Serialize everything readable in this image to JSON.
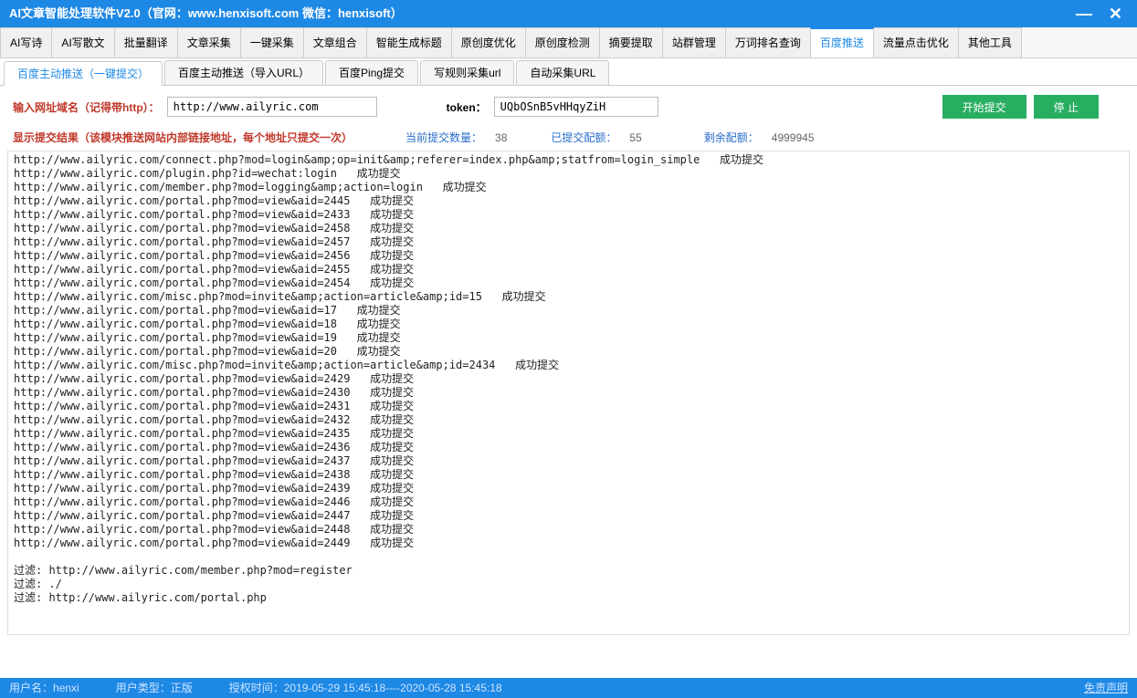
{
  "title": "AI文章智能处理软件V2.0（官网：www.henxisoft.com  微信：henxisoft）",
  "main_tabs": [
    "AI写诗",
    "AI写散文",
    "批量翻译",
    "文章采集",
    "一键采集",
    "文章组合",
    "智能生成标题",
    "原创度优化",
    "原创度检测",
    "摘要提取",
    "站群管理",
    "万词排名查询",
    "百度推送",
    "流量点击优化",
    "其他工具"
  ],
  "main_tab_active": 12,
  "sub_tabs": [
    "百度主动推送（一键提交）",
    "百度主动推送（导入URL）",
    "百度Ping提交",
    "写规则采集url",
    "自动采集URL"
  ],
  "sub_tab_active": 0,
  "input": {
    "domain_label": "输入网址域名（记得带http）：",
    "domain_value": "http://www.ailyric.com",
    "token_label": "token：",
    "token_value": "UQbOSnB5vHHqyZiH",
    "start_btn": "开始提交",
    "stop_btn": "停  止"
  },
  "status": {
    "result_label": "显示提交结果（该模块推送网站内部链接地址，每个地址只提交一次）",
    "current_label": "当前提交数量：",
    "current_val": "38",
    "submitted_label": "已提交配额：",
    "submitted_val": "55",
    "remain_label": "剩余配额：",
    "remain_val": "4999945"
  },
  "log_lines": [
    "http://www.ailyric.com/connect.php?mod=login&amp;op=init&amp;referer=index.php&amp;statfrom=login_simple   成功提交",
    "http://www.ailyric.com/plugin.php?id=wechat:login   成功提交",
    "http://www.ailyric.com/member.php?mod=logging&amp;action=login   成功提交",
    "http://www.ailyric.com/portal.php?mod=view&aid=2445   成功提交",
    "http://www.ailyric.com/portal.php?mod=view&aid=2433   成功提交",
    "http://www.ailyric.com/portal.php?mod=view&aid=2458   成功提交",
    "http://www.ailyric.com/portal.php?mod=view&aid=2457   成功提交",
    "http://www.ailyric.com/portal.php?mod=view&aid=2456   成功提交",
    "http://www.ailyric.com/portal.php?mod=view&aid=2455   成功提交",
    "http://www.ailyric.com/portal.php?mod=view&aid=2454   成功提交",
    "http://www.ailyric.com/misc.php?mod=invite&amp;action=article&amp;id=15   成功提交",
    "http://www.ailyric.com/portal.php?mod=view&aid=17   成功提交",
    "http://www.ailyric.com/portal.php?mod=view&aid=18   成功提交",
    "http://www.ailyric.com/portal.php?mod=view&aid=19   成功提交",
    "http://www.ailyric.com/portal.php?mod=view&aid=20   成功提交",
    "http://www.ailyric.com/misc.php?mod=invite&amp;action=article&amp;id=2434   成功提交",
    "http://www.ailyric.com/portal.php?mod=view&aid=2429   成功提交",
    "http://www.ailyric.com/portal.php?mod=view&aid=2430   成功提交",
    "http://www.ailyric.com/portal.php?mod=view&aid=2431   成功提交",
    "http://www.ailyric.com/portal.php?mod=view&aid=2432   成功提交",
    "http://www.ailyric.com/portal.php?mod=view&aid=2435   成功提交",
    "http://www.ailyric.com/portal.php?mod=view&aid=2436   成功提交",
    "http://www.ailyric.com/portal.php?mod=view&aid=2437   成功提交",
    "http://www.ailyric.com/portal.php?mod=view&aid=2438   成功提交",
    "http://www.ailyric.com/portal.php?mod=view&aid=2439   成功提交",
    "http://www.ailyric.com/portal.php?mod=view&aid=2446   成功提交",
    "http://www.ailyric.com/portal.php?mod=view&aid=2447   成功提交",
    "http://www.ailyric.com/portal.php?mod=view&aid=2448   成功提交",
    "http://www.ailyric.com/portal.php?mod=view&aid=2449   成功提交",
    "",
    "过滤: http://www.ailyric.com/member.php?mod=register",
    "过滤: ./",
    "过滤: http://www.ailyric.com/portal.php"
  ],
  "footer": {
    "user_label": "用户名：",
    "user_val": "henxi",
    "type_label": "用户类型：",
    "type_val": "正版",
    "auth_label": "授权时间：",
    "auth_val": "2019-05-29 15:45:18----2020-05-28 15:45:18",
    "disclaimer": "免责声明"
  }
}
